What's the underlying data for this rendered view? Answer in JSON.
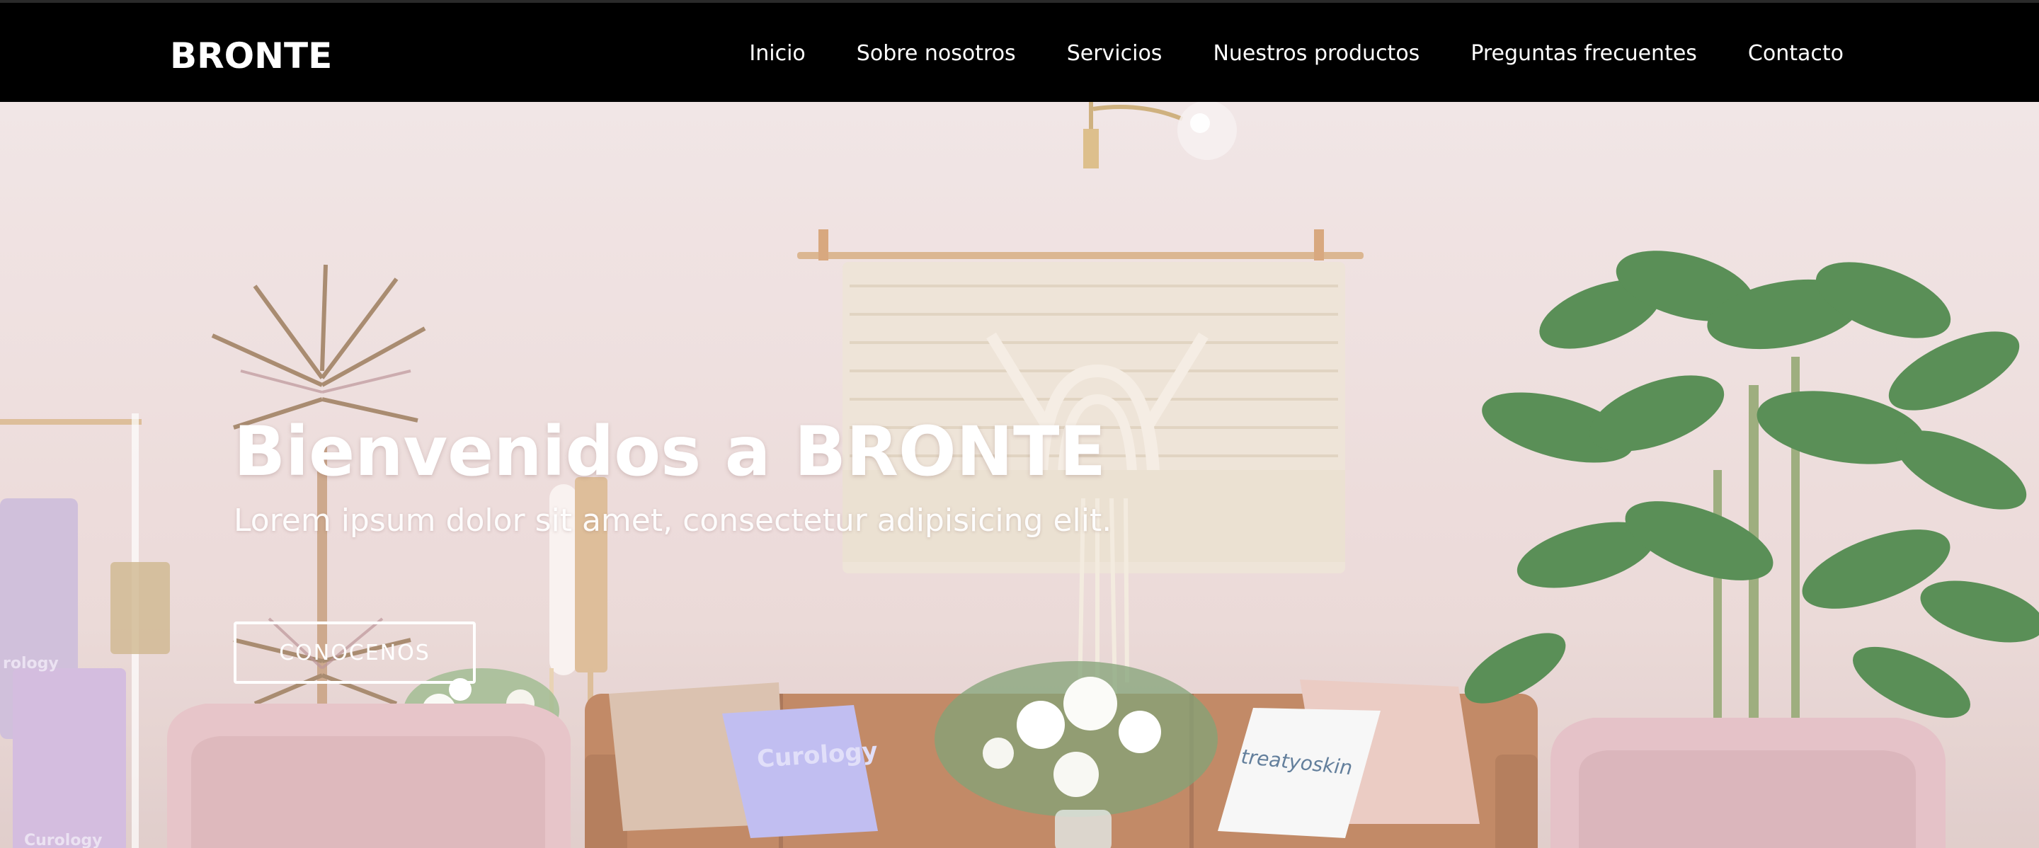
{
  "navbar": {
    "brand": "BRONTE",
    "links": [
      {
        "label": "Inicio"
      },
      {
        "label": "Sobre nosotros"
      },
      {
        "label": "Servicios"
      },
      {
        "label": "Nuestros productos"
      },
      {
        "label": "Preguntas frecuentes"
      },
      {
        "label": "Contacto"
      }
    ]
  },
  "hero": {
    "title": "Bienvenidos a BRONTE",
    "subtitle": "Lorem ipsum dolor sit amet, consectetur adipisicing elit.",
    "button_label": "CONOCENOS",
    "photo_labels": {
      "pillow_left": "Curology",
      "pillow_right": "treatyoskin",
      "towel_top": "rology",
      "towel_bottom": "Curology"
    }
  },
  "colors": {
    "navbar_bg": "#000000",
    "nav_text": "#ffffff",
    "hero_text": "#ffffff",
    "wall": "#efe2e2",
    "sofa": "#b8774e",
    "armchair": "#e3bcc0",
    "plant": "#4f8a4a",
    "pillow_lilac": "#b7b4ef"
  }
}
